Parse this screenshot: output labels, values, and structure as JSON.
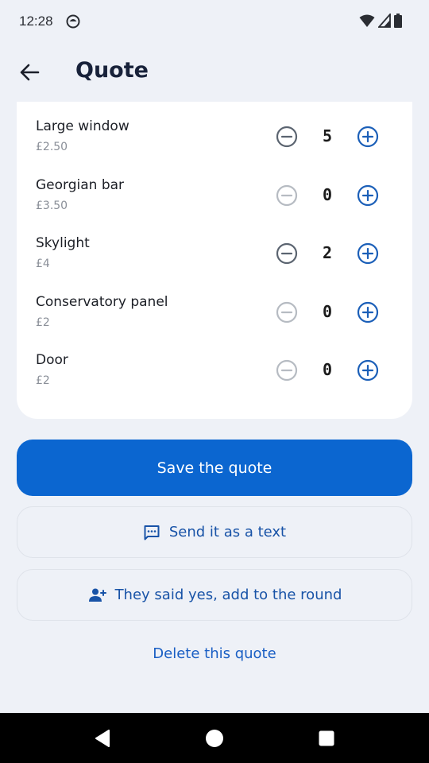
{
  "status_bar": {
    "time": "12:28"
  },
  "header": {
    "title": "Quote"
  },
  "items": [
    {
      "name": "Large window",
      "price": "£2.50",
      "quantity": "5",
      "minus_enabled": true
    },
    {
      "name": "Georgian bar",
      "price": "£3.50",
      "quantity": "0",
      "minus_enabled": false
    },
    {
      "name": "Skylight",
      "price": "£4",
      "quantity": "2",
      "minus_enabled": true
    },
    {
      "name": "Conservatory panel",
      "price": "£2",
      "quantity": "0",
      "minus_enabled": false
    },
    {
      "name": "Door",
      "price": "£2",
      "quantity": "0",
      "minus_enabled": false
    }
  ],
  "actions": {
    "save_label": "Save the quote",
    "send_text_label": "Send it as a text",
    "add_to_round_label": "They said yes, add to the round",
    "delete_label": "Delete this quote"
  },
  "icons": {
    "back": "arrow-left-icon",
    "minus": "minus-circle-icon",
    "plus": "plus-circle-icon",
    "message": "message-icon",
    "add_person": "person-add-icon",
    "nav_back": "triangle-back-icon",
    "nav_home": "circle-home-icon",
    "nav_recents": "square-recents-icon"
  },
  "colors": {
    "primary": "#0b66d0",
    "link": "#1a5fc4",
    "enabled_stepper": "#1b5fb8",
    "minus_active": "#5b6470",
    "minus_disabled": "#b6bbc2",
    "background": "#eef1f7"
  }
}
